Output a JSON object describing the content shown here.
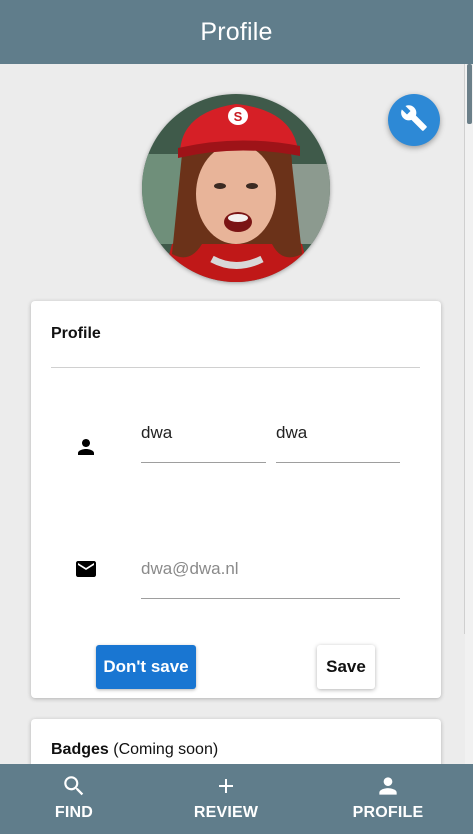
{
  "appbar": {
    "title": "Profile"
  },
  "avatar": {
    "alt": "profile photo"
  },
  "fab": {
    "icon": "wrench-icon"
  },
  "profile_card": {
    "title": "Profile",
    "first_name": "dwa",
    "last_name": "dwa",
    "email": "dwa@dwa.nl",
    "person_icon": "person-icon",
    "email_icon": "mail-icon",
    "dont_save_label": "Don't save",
    "save_label": "Save"
  },
  "badges_card": {
    "title": "Badges",
    "note": "(Coming soon)"
  },
  "bottom_nav": {
    "items": [
      {
        "label": "FIND",
        "icon": "search-icon"
      },
      {
        "label": "REVIEW",
        "icon": "plus-icon"
      },
      {
        "label": "PROFILE",
        "icon": "person-icon"
      }
    ]
  },
  "colors": {
    "primary": "#607d8b",
    "accent": "#1976d2",
    "fab": "#2d89d6",
    "background": "#ececec"
  }
}
